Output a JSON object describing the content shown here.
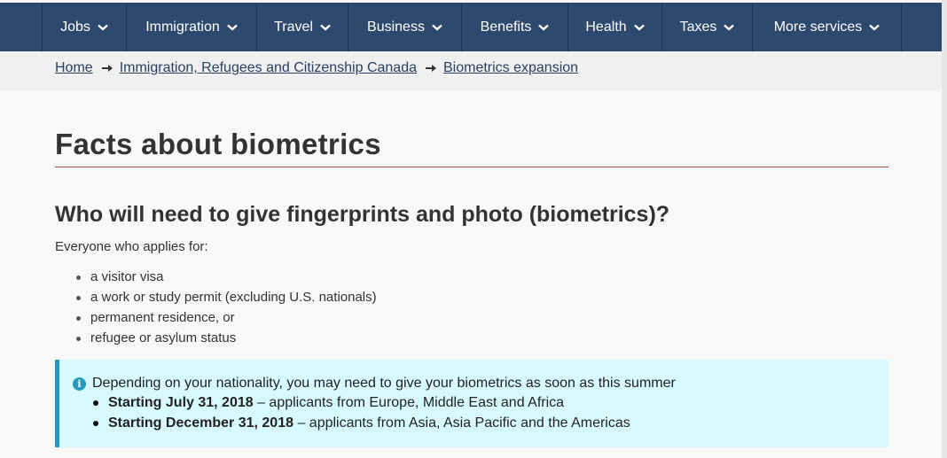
{
  "nav": {
    "items": [
      {
        "label": "Jobs"
      },
      {
        "label": "Immigration"
      },
      {
        "label": "Travel"
      },
      {
        "label": "Business"
      },
      {
        "label": "Benefits"
      },
      {
        "label": "Health"
      },
      {
        "label": "Taxes"
      },
      {
        "label": "More services"
      }
    ],
    "background": "#2d4a6e"
  },
  "breadcrumb": {
    "items": [
      {
        "label": "Home"
      },
      {
        "label": "Immigration, Refugees and Citizenship Canada"
      },
      {
        "label": "Biometrics expansion"
      }
    ]
  },
  "page": {
    "title": "Facts about biometrics",
    "heading": "Who will need to give fingerprints and photo (biometrics)?",
    "intro": "Everyone who applies for:",
    "list": [
      "a visitor visa",
      "a work or study permit (excluding U.S. nationals)",
      "permanent residence, or",
      "refugee or asylum status"
    ]
  },
  "alert": {
    "icon": "info-icon",
    "text": "Depending on your nationality, you may need to give your biometrics as soon as this summer",
    "items": [
      {
        "date": "Starting July 31, 2018",
        "rest": " – applicants from Europe, Middle East and Africa"
      },
      {
        "date": "Starting December 31, 2018",
        "rest": " – applicants from Asia, Asia Pacific and the Americas"
      }
    ],
    "accent": "#269abc",
    "background": "#d7faff"
  }
}
